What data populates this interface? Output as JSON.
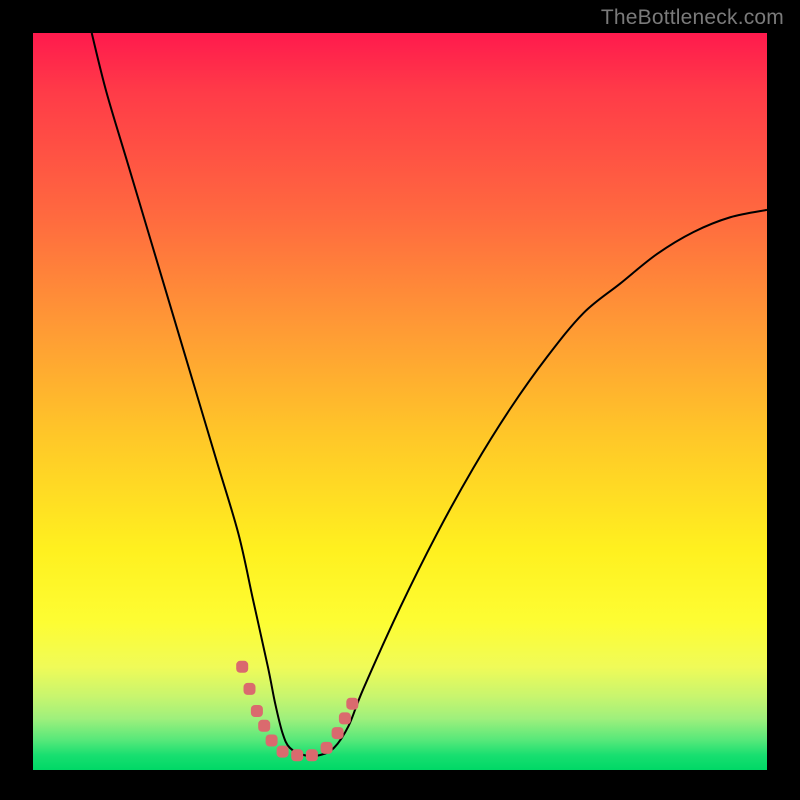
{
  "watermark": "TheBottleneck.com",
  "colors": {
    "gradient_top": "#ff1a4d",
    "gradient_mid": "#fff01f",
    "gradient_bottom": "#00d866",
    "frame": "#000000",
    "curve": "#000000",
    "markers": "#da6a6e"
  },
  "chart_data": {
    "type": "line",
    "title": "",
    "xlabel": "",
    "ylabel": "",
    "xlim": [
      0,
      100
    ],
    "ylim": [
      0,
      100
    ],
    "series": [
      {
        "name": "bottleneck-curve",
        "x": [
          8,
          10,
          13,
          16,
          19,
          22,
          25,
          28,
          30,
          32,
          33,
          34,
          35,
          37,
          39,
          41,
          43,
          45,
          50,
          55,
          60,
          65,
          70,
          75,
          80,
          85,
          90,
          95,
          100
        ],
        "values": [
          100,
          92,
          82,
          72,
          62,
          52,
          42,
          32,
          23,
          14,
          9,
          5,
          3,
          2,
          2,
          3,
          6,
          11,
          22,
          32,
          41,
          49,
          56,
          62,
          66,
          70,
          73,
          75,
          76
        ]
      }
    ],
    "markers": {
      "name": "highlight-dots",
      "x": [
        28.5,
        29.5,
        30.5,
        31.5,
        32.5,
        34,
        36,
        38,
        40,
        41.5,
        42.5,
        43.5
      ],
      "values": [
        14,
        11,
        8,
        6,
        4,
        2.5,
        2,
        2,
        3,
        5,
        7,
        9
      ]
    },
    "annotations": []
  }
}
